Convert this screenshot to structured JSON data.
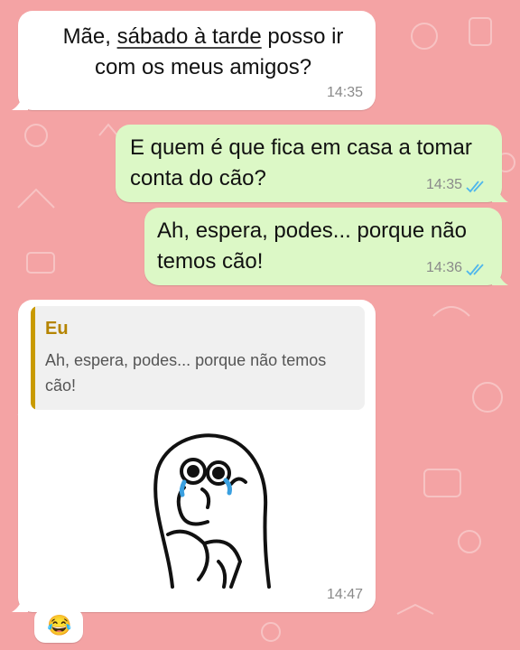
{
  "messages": [
    {
      "direction": "incoming",
      "text_line1_before": "Mãe, ",
      "text_line1_link": "sábado à tarde",
      "text_line1_after": " posso ir",
      "text_line2": "com os meus amigos?",
      "time": "14:35"
    },
    {
      "direction": "outgoing",
      "text_line1": "E quem é que fica em casa a tomar",
      "text_line2": "conta do cão?",
      "time": "14:35",
      "status": "read"
    },
    {
      "direction": "outgoing",
      "text_line1": "Ah, espera, podes... porque não",
      "text_line2": "temos cão!",
      "time": "14:36",
      "status": "read"
    },
    {
      "direction": "incoming",
      "quoted": {
        "author": "Eu",
        "text": "Ah, espera, podes... porque não temos cão!"
      },
      "sticker": "crying-meme-sticker",
      "time": "14:47"
    }
  ],
  "reaction": "😂",
  "colors": {
    "wallpaper": "#f4a3a4",
    "incoming_bubble": "#ffffff",
    "outgoing_bubble": "#dcf8c6",
    "read_ticks": "#4fb6ec",
    "quote_author": "#b58400"
  }
}
